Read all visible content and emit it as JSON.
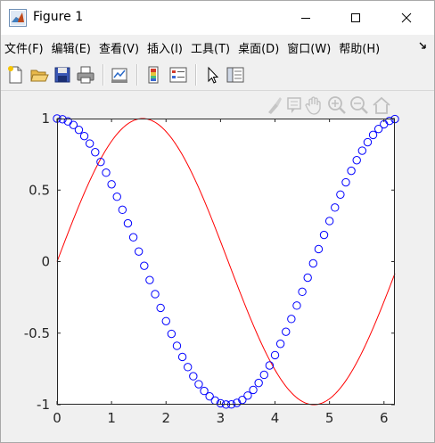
{
  "window": {
    "title": "Figure 1"
  },
  "menu": {
    "items": [
      "文件(F)",
      "编辑(E)",
      "查看(V)",
      "插入(I)",
      "工具(T)",
      "桌面(D)",
      "窗口(W)",
      "帮助(H)"
    ],
    "overflow_icon": "double-chevron-right-icon"
  },
  "toolbar": {
    "icons": [
      "new-figure-icon",
      "open-file-icon",
      "save-icon",
      "print-icon",
      "link-plot-icon",
      "insert-colorbar-icon",
      "insert-legend-icon",
      "edit-plot-icon",
      "property-inspector-icon"
    ]
  },
  "axes_toolbar": {
    "icons": [
      "brush-icon",
      "data-tips-icon",
      "pan-icon",
      "zoom-in-icon",
      "zoom-out-icon",
      "restore-view-icon"
    ]
  },
  "colors": {
    "line_red": "#ff0000",
    "marker_blue": "#0000ff",
    "axes_bg": "#ffffff",
    "figure_bg": "#f0f0f0",
    "axis_color": "#262626"
  },
  "chart_data": {
    "type": "line",
    "title": "",
    "xlabel": "",
    "ylabel": "",
    "xlim": [
      0,
      6.2
    ],
    "ylim": [
      -1,
      1
    ],
    "grid": false,
    "x_ticks": [
      "0",
      "1",
      "2",
      "3",
      "4",
      "5",
      "6"
    ],
    "y_ticks": [
      "-1",
      "-0.5",
      "0",
      "0.5",
      "1"
    ],
    "series": [
      {
        "style": "red solid line",
        "color": "#ff0000",
        "x_start": 0,
        "x_end": 6.2,
        "function_shape": "sin(x)",
        "x": [
          0,
          0.5,
          1.0,
          1.5708,
          2.0,
          2.5,
          3.0,
          3.1416,
          3.5,
          4.0,
          4.7124,
          5.0,
          5.5,
          6.0,
          6.2
        ],
        "y": [
          0,
          0.479,
          0.841,
          1.0,
          0.909,
          0.598,
          0.141,
          0,
          -0.351,
          -0.757,
          -1.0,
          -0.959,
          -0.706,
          -0.279,
          -0.083
        ]
      },
      {
        "style": "blue open circle markers",
        "color": "#0000ff",
        "marker": "o",
        "x_start": 0,
        "x_end": 6.2,
        "x_step": 0.1,
        "function_shape": "cos(x)"
      }
    ]
  }
}
